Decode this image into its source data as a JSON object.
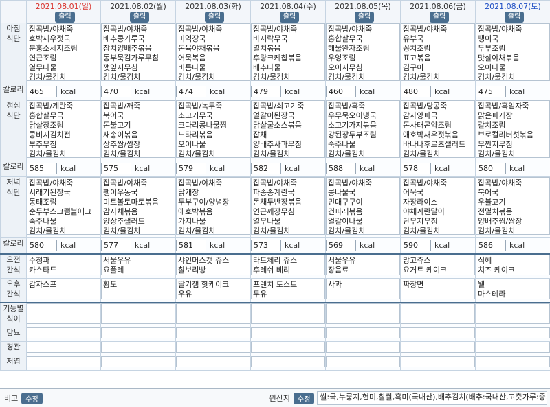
{
  "buttons": {
    "print": "출력",
    "edit": "수정"
  },
  "unit": "kcal",
  "days": [
    {
      "date": "2021.08.01(일)",
      "kind": "sun",
      "breakfast": [
        "잡곡밥/야채죽",
        "호박새우젓국",
        "분홍소세지조림",
        "연근조림",
        "열무나물",
        "김치/물김치"
      ],
      "breakfast_kcal": "465",
      "lunch": [
        "잡곡밥/계란죽",
        "홍합살무국",
        "닭살장조림",
        "콩비지김치전",
        "부추무침",
        "김치/물김치"
      ],
      "lunch_kcal": "585",
      "dinner": [
        "잡곡밥/야채죽",
        "시래기된장국",
        "동태조림",
        "순두부스크램블에그",
        "숙주나물",
        "김치/물김치"
      ],
      "dinner_kcal": "580",
      "snack_am": [
        "수정과",
        "카스타드"
      ],
      "snack_pm": [
        "감자스프"
      ]
    },
    {
      "date": "2021.08.02(월)",
      "kind": "wk",
      "breakfast": [
        "잡곡밥/야채죽",
        "배추콩가루국",
        "참치양배추볶음",
        "동부묵김가루무침",
        "깻잎지무침",
        "김치/물김치"
      ],
      "breakfast_kcal": "470",
      "lunch": [
        "잡곡밥/깨죽",
        "북어국",
        "돈불고기",
        "새송이볶음",
        "상추쌈/쌈장",
        "김치/물김치"
      ],
      "lunch_kcal": "575",
      "dinner": [
        "잡곡밥/야채죽",
        "팽이우동국",
        "미트볼토마토볶음",
        "감자채볶음",
        "양상추샐러드",
        "김치/물김치"
      ],
      "dinner_kcal": "577",
      "snack_am": [
        "서울우유",
        "요플레"
      ],
      "snack_pm": [
        "황도"
      ]
    },
    {
      "date": "2021.08.03(화)",
      "kind": "wk",
      "breakfast": [
        "잡곡밥/야채죽",
        "미역장국",
        "돈육야채볶음",
        "어묵볶음",
        "비름나물",
        "김치/물김치"
      ],
      "breakfast_kcal": "474",
      "lunch": [
        "잡곡밥/녹두죽",
        "소고기무국",
        "코다리콩나물찜",
        "느타리볶음",
        "오이나물",
        "김치/물김치"
      ],
      "lunch_kcal": "579",
      "dinner": [
        "잡곡밥/야채죽",
        "닭개장",
        "두부구이/양념장",
        "애호박볶음",
        "가지나물",
        "김치/물김치"
      ],
      "dinner_kcal": "581",
      "snack_am": [
        "샤인머스캣 쥬스",
        "찰보리빵"
      ],
      "snack_pm": [
        "딸기잼 핫케이크",
        "우유"
      ]
    },
    {
      "date": "2021.08.04(수)",
      "kind": "wk",
      "breakfast": [
        "잡곡밥/야채죽",
        "바지락무국",
        "멸치볶음",
        "후랑크케찹볶음",
        "배추나물",
        "김치/물김치"
      ],
      "breakfast_kcal": "479",
      "lunch": [
        "잡곡밥/쇠고기죽",
        "얼갈이된장국",
        "닭살굴소스볶음",
        "잡채",
        "양배추사과무침",
        "김치/물김치"
      ],
      "lunch_kcal": "582",
      "dinner": [
        "잡곡밥/야채죽",
        "파송송계란국",
        "돈채두반장볶음",
        "연근깨장무침",
        "열무나물",
        "김치/물김치"
      ],
      "dinner_kcal": "573",
      "snack_am": [
        "타트체리 쥬스",
        "후레쉬 베리"
      ],
      "snack_pm": [
        "프렌치 토스트",
        "두유"
      ]
    },
    {
      "date": "2021.08.05(목)",
      "kind": "wk",
      "breakfast": [
        "잡곡밥/야채죽",
        "홍합살무국",
        "해물완자조림",
        "우엉조림",
        "오이지무침",
        "김치/물김치"
      ],
      "breakfast_kcal": "460",
      "lunch": [
        "잡곡밥/흑죽",
        "우무묵오이냉국",
        "소고기가지볶음",
        "강된장두부조림",
        "숙주나물",
        "김치/물김치"
      ],
      "lunch_kcal": "588",
      "dinner": [
        "잡곡밥/야채죽",
        "콩나물국",
        "민대구구이",
        "건파래볶음",
        "얼갈이나물",
        "김치/물김치"
      ],
      "dinner_kcal": "569",
      "snack_am": [
        "서울우유",
        "장음료"
      ],
      "snack_pm": [
        "사과"
      ]
    },
    {
      "date": "2021.08.06(금)",
      "kind": "wk",
      "breakfast": [
        "잡곡밥/야채죽",
        "유부국",
        "꽁치조림",
        "표고볶음",
        "김구이",
        "김치/물김치"
      ],
      "breakfast_kcal": "480",
      "lunch": [
        "잡곡밥/당콩죽",
        "감자양파국",
        "돈사태곤약조림",
        "애호박새우젓볶음",
        "바나나후르츠샐러드",
        "김치/물김치"
      ],
      "lunch_kcal": "578",
      "dinner": [
        "잡곡밥/야채죽",
        "어묵국",
        "자장라이스",
        "야채계란말이",
        "단무지무침",
        "김치/물김치"
      ],
      "dinner_kcal": "590",
      "snack_am": [
        "망고쥬스",
        "요거트 케이크"
      ],
      "snack_pm": [
        "짜장면"
      ]
    },
    {
      "date": "2021.08.07(토)",
      "kind": "sat",
      "breakfast": [
        "잡곡밥/야채죽",
        "팽이국",
        "두부조림",
        "맛살야채볶음",
        "오이나물",
        "김치/물김치"
      ],
      "breakfast_kcal": "475",
      "lunch": [
        "잡곡밥/흑임자죽",
        "맑은파개장",
        "갈치조림",
        "브로컬리버섯볶음",
        "무짠지무침",
        "김치/물김치"
      ],
      "lunch_kcal": "580",
      "dinner": [
        "잡곡밥/야채죽",
        "북어국",
        "우불고기",
        "전멸치볶음",
        "양배추찜/쌈장",
        "김치/물김치"
      ],
      "dinner_kcal": "586",
      "snack_am": [
        "식혜",
        "치즈 케이크"
      ],
      "snack_pm": [
        "웰",
        "마스테라"
      ]
    }
  ],
  "labels": {
    "breakfast": [
      "아침",
      "식단"
    ],
    "lunch": [
      "점심",
      "식단"
    ],
    "dinner": [
      "저녁",
      "식단"
    ],
    "calorie": "칼로리",
    "snack_am": [
      "오전",
      "간식"
    ],
    "snack_pm": [
      "오후",
      "간식"
    ],
    "functional": [
      "기능별",
      "식이"
    ],
    "diabetes": "당뇨",
    "tube": "경관",
    "lowsalt": "저염"
  },
  "footer": {
    "remark_label": "비고",
    "origin_label": "원산지",
    "origin_text": "쌀:국,누룽지,현미,찰쌀,흑미(국내산),배추김치(배추:국내산,고춧가루:중..."
  }
}
